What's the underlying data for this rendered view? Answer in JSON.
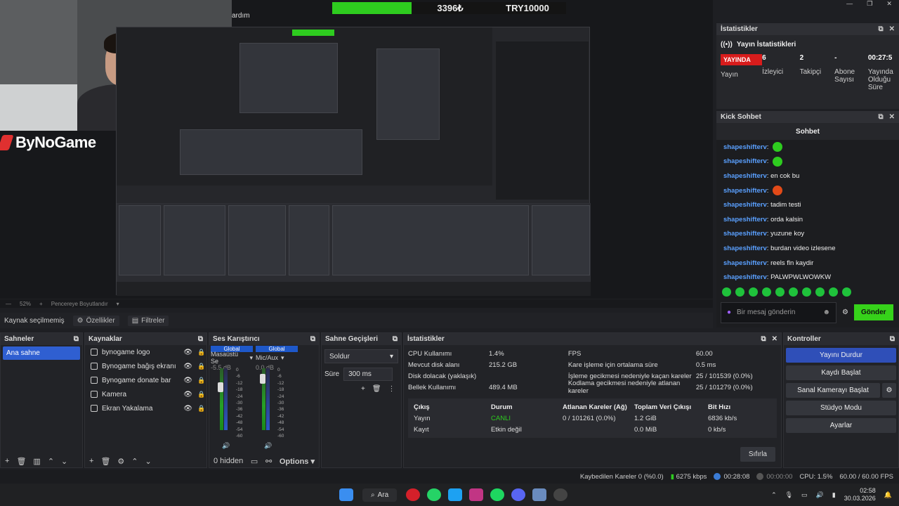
{
  "overlay": {
    "top_amount": "3396₺",
    "top_goal": "TRY10000",
    "brand": "ByNoGame",
    "cut_menu_text": "ardım"
  },
  "window_controls": {
    "minimize": "—",
    "maximize": "❐",
    "close": "✕"
  },
  "preview": {
    "zoom": "52%",
    "fit_label": "Pencereye Boyutlandır"
  },
  "stats_panel": {
    "title": "İstatistikler",
    "heading": "Yayın İstatistikleri",
    "live_badge": "YAYINDA",
    "stream_label": "Yayın",
    "viewers_value": "6",
    "viewers_label": "İzleyici",
    "followers_value": "2",
    "followers_label": "Takipçi",
    "subs_value": "-",
    "subs_label": "Abone Sayısı",
    "time_value": "00:27:5",
    "time_label": "Yayında Olduğu Süre"
  },
  "chat_panel": {
    "title": "Kick Sohbet",
    "subtitle": "Sohbet",
    "messages": [
      {
        "user": "shapeshifterv",
        "text": "",
        "emoji": "green"
      },
      {
        "user": "shapeshifterv",
        "text": "",
        "emoji": "green"
      },
      {
        "user": "shapeshifterv",
        "text": "en cok bu",
        "emoji": ""
      },
      {
        "user": "shapeshifterv",
        "text": "",
        "emoji": "red"
      },
      {
        "user": "shapeshifterv",
        "text": "tadim testi",
        "emoji": ""
      },
      {
        "user": "shapeshifterv",
        "text": "orda kalsin",
        "emoji": ""
      },
      {
        "user": "shapeshifterv",
        "text": "yuzune koy",
        "emoji": ""
      },
      {
        "user": "shapeshifterv",
        "text": "burdan video izlesene",
        "emoji": ""
      },
      {
        "user": "shapeshifterv",
        "text": "reels fln kaydir",
        "emoji": ""
      },
      {
        "user": "shapeshifterv",
        "text": "PALWPWLWOWKW",
        "emoji": ""
      }
    ],
    "placeholder": "Bir mesaj gönderin",
    "send_label": "Gönder"
  },
  "props_bar": {
    "no_source": "Kaynak seçilmemiş",
    "properties": "Özellikler",
    "filters": "Filtreler"
  },
  "scenes": {
    "title": "Sahneler",
    "items": [
      "Ana sahne"
    ]
  },
  "sources": {
    "title": "Kaynaklar",
    "items": [
      "bynogame logo",
      "Bynogame bağış ekranı",
      "Bynogame donate bar",
      "Kamera",
      "Ekran Yakalama"
    ]
  },
  "mixer": {
    "title": "Ses Karıştırıcı",
    "global": "Global",
    "ch1_name": "Masaüstü Se",
    "ch1_db": "-5.5 dB",
    "ch2_name": "Mic/Aux",
    "ch2_db": "0.0 dB",
    "scale": [
      "0",
      "-6",
      "-12",
      "-18",
      "-24",
      "-30",
      "-36",
      "-42",
      "-48",
      "-54",
      "-60"
    ],
    "hidden": "0 hidden",
    "options": "Options"
  },
  "transitions": {
    "title": "Sahne Geçişleri",
    "selected": "Soldur",
    "duration_label": "Süre",
    "duration_value": "300 ms"
  },
  "statistics": {
    "title": "İstatistikler",
    "left": [
      {
        "label": "CPU Kullanımı",
        "value": "1.4%"
      },
      {
        "label": "Mevcut disk alanı",
        "value": "215.2 GB"
      },
      {
        "label": "Disk dolacak (yaklaşık)",
        "value": ""
      },
      {
        "label": "Bellek Kullanımı",
        "value": "489.4 MB"
      }
    ],
    "right": [
      {
        "label": "FPS",
        "value": "60.00"
      },
      {
        "label": "Kare işleme için ortalama süre",
        "value": "0.5 ms"
      },
      {
        "label": "İşleme gecikmesi nedeniyle kaçan kareler",
        "value": "25 / 101539 (0.0%)"
      },
      {
        "label": "Kodlama gecikmesi nedeniyle atlanan kareler",
        "value": "25 / 101279 (0.0%)"
      }
    ],
    "table_headers": [
      "Çıkış",
      "Durum",
      "Atlanan Kareler (Ağ)",
      "Toplam Veri Çıkışı",
      "Bit Hızı"
    ],
    "table_rows": [
      [
        "Yayın",
        "CANLI",
        "0 / 101261 (0.0%)",
        "1.2 GiB",
        "6836 kb/s"
      ],
      [
        "Kayıt",
        "Etkin değil",
        "",
        "0.0 MiB",
        "0 kb/s"
      ]
    ],
    "reset": "Sıfırla"
  },
  "controls": {
    "title": "Kontroller",
    "stop_stream": "Yayını Durdur",
    "start_record": "Kaydı Başlat",
    "virtual_cam": "Sanal Kamerayı Başlat",
    "studio_mode": "Stüdyo Modu",
    "settings": "Ayarlar"
  },
  "status_bar": {
    "dropped": "Kaybedilen Kareler 0 (%0.0)",
    "bitrate": "6275 kbps",
    "stream_time": "00:28:08",
    "rec_time": "00:00:00",
    "cpu": "CPU: 1.5%",
    "fps": "60.00 / 60.00 FPS"
  },
  "taskbar": {
    "search": "Ara",
    "time": "02:58",
    "date": "30.03.2026"
  },
  "colors": {
    "accent_blue": "#2f4fb8",
    "live_red": "#d81c1c",
    "kick_green": "#36d21a",
    "chat_user": "#5aa0ff"
  }
}
